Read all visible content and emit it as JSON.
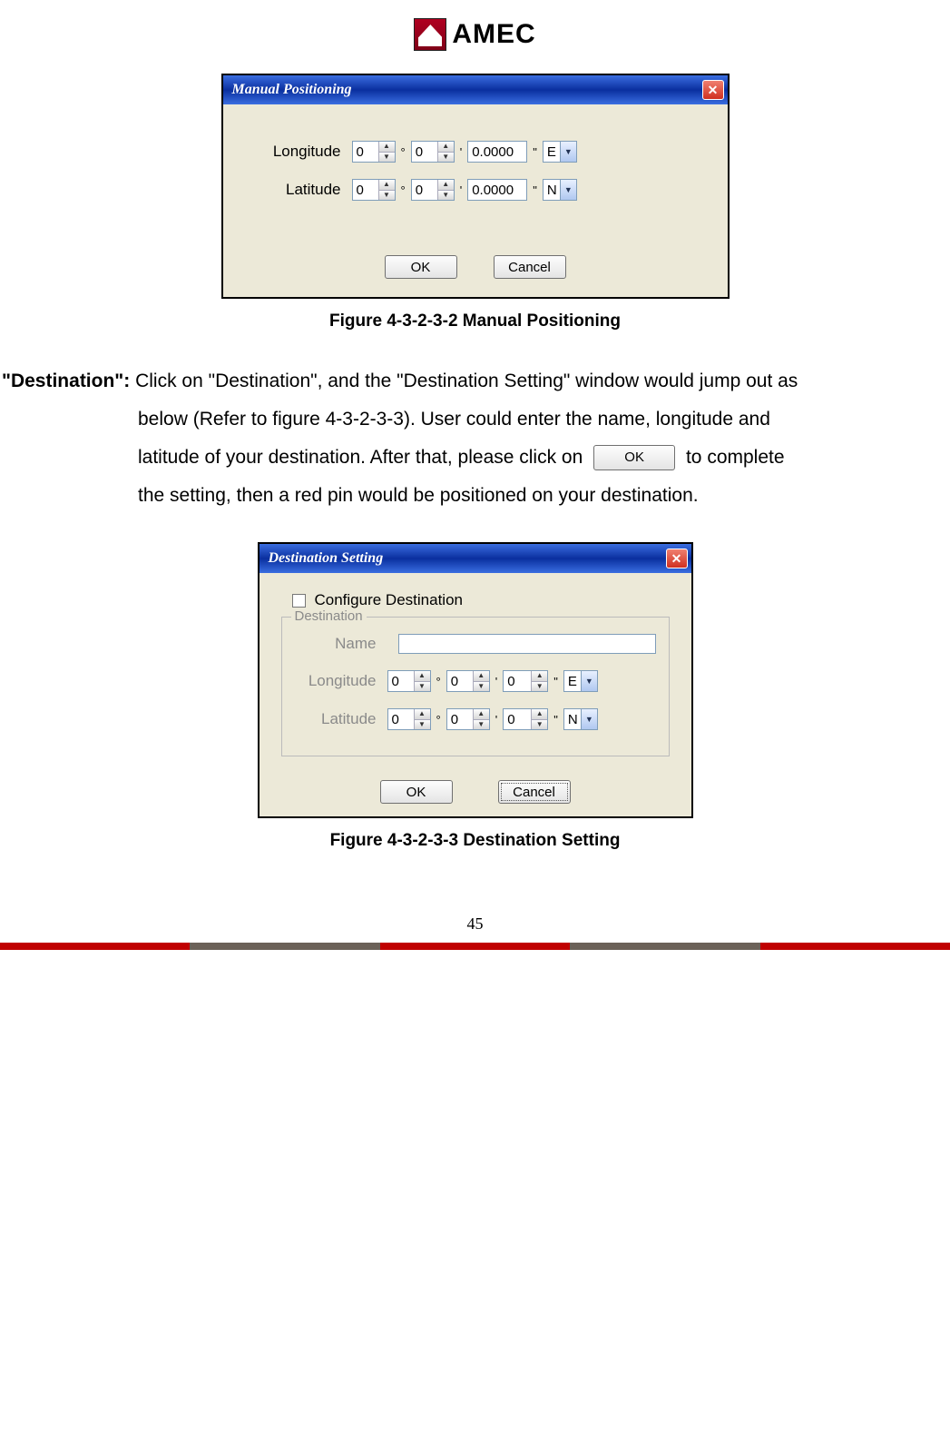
{
  "logo_text": "AMEC",
  "dialog1": {
    "title": "Manual Positioning",
    "close": "✕",
    "longitude_label": "Longitude",
    "latitude_label": "Latitude",
    "deg_val": "0",
    "min_val": "0",
    "sec_val": "0.0000",
    "lon_dir": "E",
    "lat_dir": "N",
    "ok": "OK",
    "cancel": "Cancel"
  },
  "caption1": "Figure 4-3-2-3-2 Manual Positioning",
  "para": {
    "lead": "\"Destination\": ",
    "line1a": "Click on \"Destination\", and the \"Destination Setting\" window would jump out as",
    "line2": "below (Refer to figure 4-3-2-3-3). User could enter the name, longitude and",
    "line3a": "latitude of your destination. After that, please click on ",
    "inline_ok": "OK",
    "line3b": " to complete",
    "line4": "the setting, then a red pin would be positioned on your destination."
  },
  "dialog2": {
    "title": "Destination Setting",
    "close": "✕",
    "configure": "Configure Destination",
    "legend": "Destination",
    "name_label": "Name",
    "longitude_label": "Longitude",
    "latitude_label": "Latitude",
    "deg_val": "0",
    "min_val": "0",
    "sec_val": "0",
    "lon_dir": "E",
    "lat_dir": "N",
    "ok": "OK",
    "cancel": "Cancel"
  },
  "caption2": "Figure 4-3-2-3-3 Destination Setting",
  "page_num": "45"
}
